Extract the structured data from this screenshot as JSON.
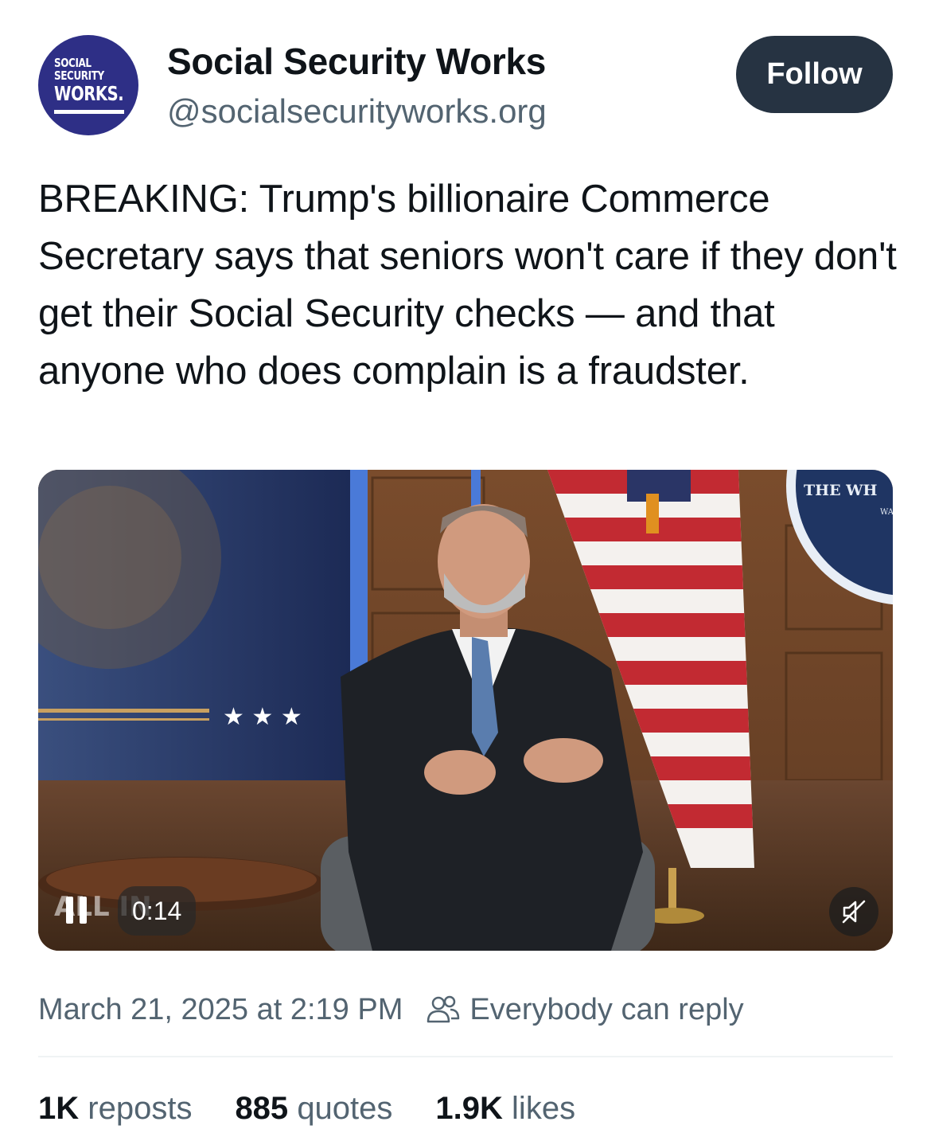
{
  "author": {
    "avatar_text": [
      "SOCIAL",
      "SECURITY",
      "WORKS."
    ],
    "name": "Social Security Works",
    "handle": "@socialsecurityworks.org",
    "avatar_color": "#2e2f86"
  },
  "follow_button": {
    "label": "Follow",
    "color": "#263342"
  },
  "post": {
    "text": "BREAKING: Trump's billionaire Commerce Secretary says that seniors won't care if they don't get their Social Security checks — and that anyone who does complain is a fraudster."
  },
  "media": {
    "duration": "0:14",
    "play_icon": "pause-icon",
    "mute_icon": "muted-speaker-icon",
    "seal_text": "THE WH",
    "seal_subtext": "WAS",
    "watermark": "ALL IN"
  },
  "meta": {
    "timestamp": "March 21, 2025 at 2:19 PM",
    "reply_setting": "Everybody can reply",
    "reply_icon": "people-icon"
  },
  "stats": [
    {
      "value": "1K",
      "label": "reposts"
    },
    {
      "value": "885",
      "label": "quotes"
    },
    {
      "value": "1.9K",
      "label": "likes"
    }
  ]
}
